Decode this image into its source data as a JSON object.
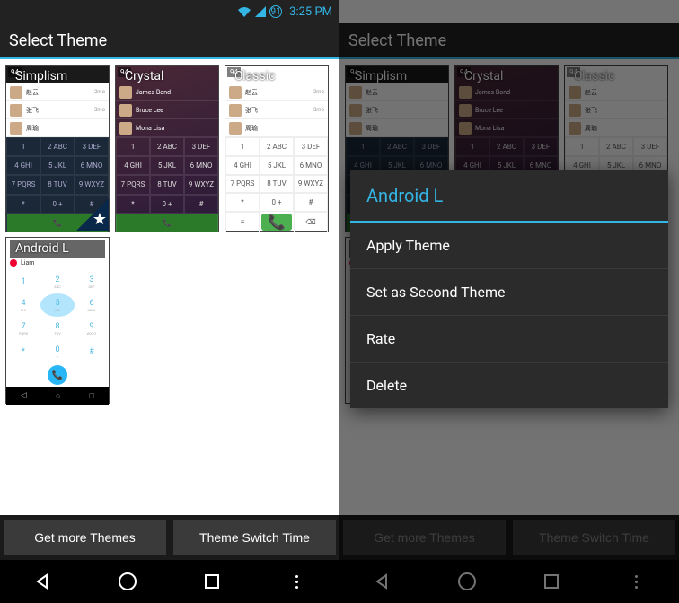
{
  "statusbar": {
    "battery": "91",
    "time": "3:25 PM"
  },
  "titlebar": {
    "title": "Select Theme"
  },
  "themes": [
    {
      "label": "Simplism",
      "badge": "94",
      "selected": true
    },
    {
      "label": "Crystal",
      "badge": "94",
      "selected": false
    },
    {
      "label": "Classic",
      "badge": "94",
      "selected": false
    },
    {
      "label": "Android L",
      "badge": "",
      "selected": false
    }
  ],
  "dialpad_keys": [
    "1",
    "2 ABC",
    "3 DEF",
    "4 GHI",
    "5 JKL",
    "6 MNO",
    "7 PQRS",
    "8 TUV",
    "9 WXYZ",
    "*",
    "0 +",
    "#"
  ],
  "contacts_cn": [
    {
      "name": "赵云",
      "sub": "2mo"
    },
    {
      "name": "张飞",
      "sub": "3mo"
    },
    {
      "name": "周瑜",
      "sub": ""
    }
  ],
  "contacts_en": [
    {
      "name": "James Bond",
      "sub": "James Bond"
    },
    {
      "name": "Bruce Lee",
      "sub": ""
    },
    {
      "name": "Mona Lisa",
      "sub": ""
    }
  ],
  "androidl_contact": "Liam",
  "bottombar": {
    "get_more": "Get more Themes",
    "switch_time": "Theme Switch Time"
  },
  "dialog": {
    "title": "Android L",
    "items": [
      "Apply Theme",
      "Set as Second Theme",
      "Rate",
      "Delete"
    ]
  }
}
